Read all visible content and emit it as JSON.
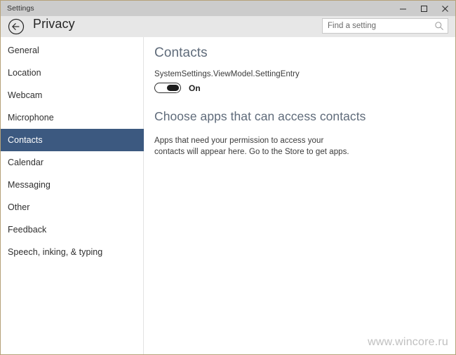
{
  "window": {
    "titlebar_text": "Settings",
    "controls": [
      {
        "name": "minimize",
        "label": "–"
      },
      {
        "name": "maximize",
        "label": "□"
      },
      {
        "name": "close",
        "label": "×"
      }
    ],
    "border_color": "#b6a279",
    "titlebar_color": "#cccccc",
    "header_color": "#e7e7e7"
  },
  "header": {
    "back_icon": "back-arrow-circle-icon",
    "title": "Privacy"
  },
  "search": {
    "placeholder": "Find a setting",
    "value": "",
    "icon": "search-icon"
  },
  "sidebar": {
    "items": [
      {
        "label": "General",
        "selected": false
      },
      {
        "label": "Location",
        "selected": false
      },
      {
        "label": "Webcam",
        "selected": false
      },
      {
        "label": "Microphone",
        "selected": false
      },
      {
        "label": "Contacts",
        "selected": true
      },
      {
        "label": "Calendar",
        "selected": false
      },
      {
        "label": "Messaging",
        "selected": false
      },
      {
        "label": "Other",
        "selected": false
      },
      {
        "label": "Feedback",
        "selected": false
      },
      {
        "label": "Speech, inking, & typing",
        "selected": false
      }
    ],
    "selected_color": "#3c5980"
  },
  "main": {
    "section_title": "Contacts",
    "setting_entry_label": "SystemSettings.ViewModel.SettingEntry",
    "toggle": {
      "state": "on",
      "state_label": "On"
    },
    "apps_heading": "Choose apps that can access contacts",
    "apps_description": "Apps that need your permission to access your contacts will appear here. Go to the Store to get apps.",
    "heading_color": "#5f6b7a"
  },
  "watermark": {
    "text": "www.wincore.ru"
  }
}
